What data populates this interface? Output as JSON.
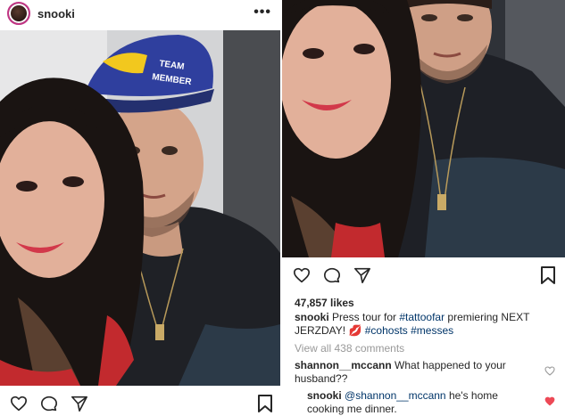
{
  "left_post": {
    "username": "snooki",
    "more_label": "•••",
    "photo_cap_text": "TEAM\nMEMBER"
  },
  "right_post": {
    "likes": "47,857 likes",
    "caption": {
      "username": "snooki",
      "text_before": " Press tour for ",
      "tag1": "#tattoofar",
      "text_mid": " premiering NEXT JERZDAY! ",
      "emoji": "💋",
      "tag2": "#cohosts",
      "tag3": "#messes"
    },
    "view_all": "View all 438 comments",
    "comments": [
      {
        "username": "shannon__mccann",
        "text": " What happened to your husband??",
        "liked": false
      },
      {
        "username": "snooki",
        "mention": "@shannon__mccann",
        "text": " he's home cooking me dinner.",
        "liked": true
      }
    ]
  },
  "colors": {
    "heart_liked": "#ed4956",
    "link": "#003569",
    "muted": "#999999",
    "cap_blue": "#2f3f9e",
    "cap_yellow": "#f2c81e"
  },
  "icons": [
    "more-icon",
    "heart-icon",
    "comment-icon",
    "share-icon",
    "bookmark-icon"
  ]
}
